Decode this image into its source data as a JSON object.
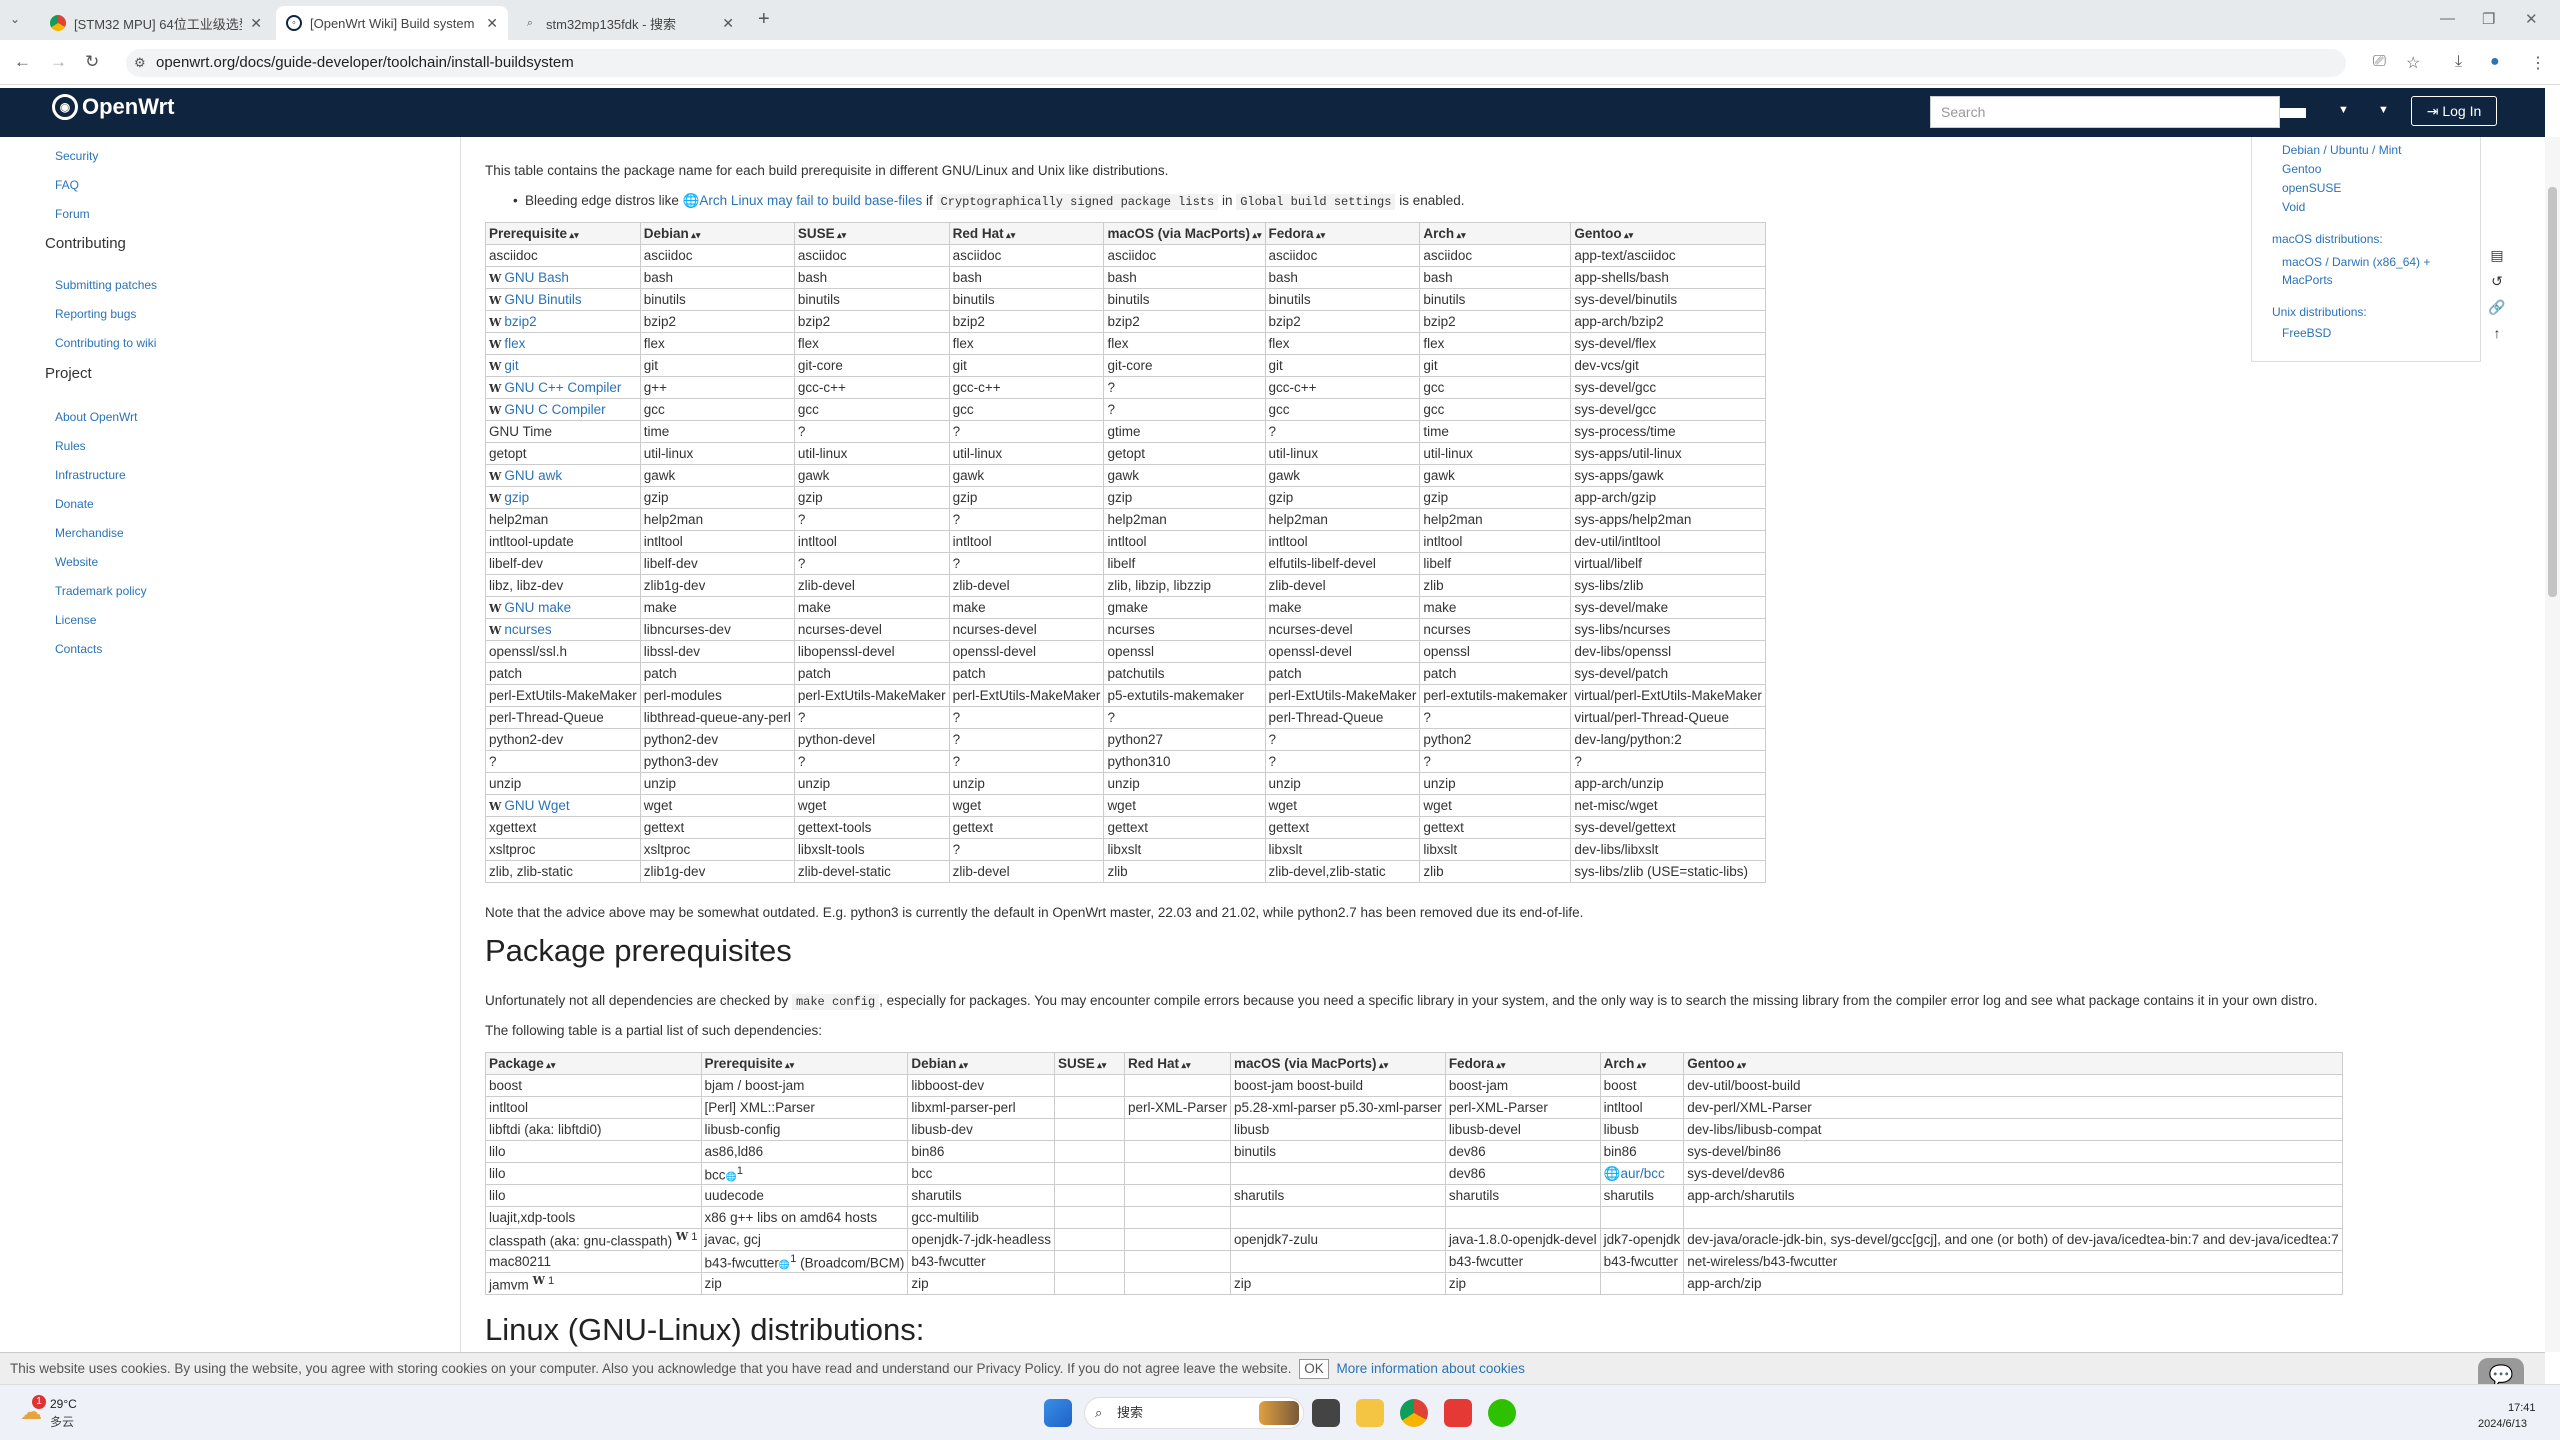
{
  "browser": {
    "tabs": [
      {
        "title": "[STM32 MPU] 64位工业级选型",
        "favicon": "chrome-icon"
      },
      {
        "title": "[OpenWrt Wiki] Build system",
        "favicon": "openwrt-icon"
      },
      {
        "title": "stm32mp135fdk - 搜索",
        "favicon": "search-icon"
      }
    ],
    "url": "openwrt.org/docs/guide-developer/toolchain/install-buildsystem"
  },
  "header": {
    "logo": "OpenWrt",
    "search_placeholder": "Search",
    "login": "Log In"
  },
  "sidebar": {
    "top_items": [
      "Security",
      "FAQ",
      "Forum"
    ],
    "contributing_heading": "Contributing",
    "contributing_items": [
      "Submitting patches",
      "Reporting bugs",
      "Contributing to wiki"
    ],
    "project_heading": "Project",
    "project_items": [
      "About OpenWrt",
      "Rules",
      "Infrastructure",
      "Donate",
      "Merchandise",
      "Website",
      "Trademark policy",
      "License",
      "Contacts"
    ]
  },
  "toc": {
    "linux_items": [
      "Debian / Ubuntu / Mint",
      "Gentoo",
      "openSUSE",
      "Void"
    ],
    "macos_heading": "macOS distributions:",
    "macos_item_1": "macOS / Darwin (x86_64) +",
    "macos_item_2": "MacPorts",
    "unix_heading": "Unix distributions:",
    "unix_item": "FreeBSD"
  },
  "content": {
    "intro": "This table contains the package name for each build prerequisite in different GNU/Linux and Unix like distributions.",
    "bullet_pre": "Bleeding edge distros like ",
    "bullet_link": "Arch Linux may fail to build base-files",
    "bullet_if": " if ",
    "bullet_code1": "Cryptographically signed package lists",
    "bullet_in": " in ",
    "bullet_code2": "Global build settings",
    "bullet_post": " is enabled.",
    "note": "Note that the advice above may be somewhat outdated. E.g. python3 is currently the default in OpenWrt master, 22.03 and 21.02, while python2.7 has been removed due its end-of-life.",
    "h_packages": "Package prerequisites",
    "pkg_intro_pre": "Unfortunately not all dependencies are checked by ",
    "pkg_intro_code": "make config",
    "pkg_intro_post": ", especially for packages. You may encounter compile errors because you need a specific library in your system, and the only way is to search the missing library from the compiler error log and see what package contains it in your own distro.",
    "pkg_intro2": "The following table is a partial list of such dependencies:",
    "h_linux": "Linux (GNU-Linux) distributions:"
  },
  "prereq_table": {
    "headers": [
      "Prerequisite",
      "Debian",
      "SUSE",
      "Red Hat",
      "macOS (via MacPorts)",
      "Fedora",
      "Arch",
      "Gentoo"
    ],
    "rows": [
      [
        "asciidoc",
        "asciidoc",
        "asciidoc",
        "asciidoc",
        "asciidoc",
        "asciidoc",
        "asciidoc",
        "app-text/asciidoc"
      ],
      [
        "GNU Bash",
        "bash",
        "bash",
        "bash",
        "bash",
        "bash",
        "bash",
        "app-shells/bash"
      ],
      [
        "GNU Binutils",
        "binutils",
        "binutils",
        "binutils",
        "binutils",
        "binutils",
        "binutils",
        "sys-devel/binutils"
      ],
      [
        "bzip2",
        "bzip2",
        "bzip2",
        "bzip2",
        "bzip2",
        "bzip2",
        "bzip2",
        "app-arch/bzip2"
      ],
      [
        "flex",
        "flex",
        "flex",
        "flex",
        "flex",
        "flex",
        "flex",
        "sys-devel/flex"
      ],
      [
        "git",
        "git",
        "git-core",
        "git",
        "git-core",
        "git",
        "git",
        "dev-vcs/git"
      ],
      [
        "GNU C++ Compiler",
        "g++",
        "gcc-c++",
        "gcc-c++",
        "?",
        "gcc-c++",
        "gcc",
        "sys-devel/gcc"
      ],
      [
        "GNU C Compiler",
        "gcc",
        "gcc",
        "gcc",
        "?",
        "gcc",
        "gcc",
        "sys-devel/gcc"
      ],
      [
        "GNU Time",
        "time",
        "?",
        "?",
        "gtime",
        "?",
        "time",
        "sys-process/time"
      ],
      [
        "getopt",
        "util-linux",
        "util-linux",
        "util-linux",
        "getopt",
        "util-linux",
        "util-linux",
        "sys-apps/util-linux"
      ],
      [
        "GNU awk",
        "gawk",
        "gawk",
        "gawk",
        "gawk",
        "gawk",
        "gawk",
        "sys-apps/gawk"
      ],
      [
        "gzip",
        "gzip",
        "gzip",
        "gzip",
        "gzip",
        "gzip",
        "gzip",
        "app-arch/gzip"
      ],
      [
        "help2man",
        "help2man",
        "?",
        "?",
        "help2man",
        "help2man",
        "help2man",
        "sys-apps/help2man"
      ],
      [
        "intltool-update",
        "intltool",
        "intltool",
        "intltool",
        "intltool",
        "intltool",
        "intltool",
        "dev-util/intltool"
      ],
      [
        "libelf-dev",
        "libelf-dev",
        "?",
        "?",
        "libelf",
        "elfutils-libelf-devel",
        "libelf",
        "virtual/libelf"
      ],
      [
        "libz, libz-dev",
        "zlib1g-dev",
        "zlib-devel",
        "zlib-devel",
        "zlib, libzip, libzzip",
        "zlib-devel",
        "zlib",
        "sys-libs/zlib"
      ],
      [
        "GNU make",
        "make",
        "make",
        "make",
        "gmake",
        "make",
        "make",
        "sys-devel/make"
      ],
      [
        "ncurses",
        "libncurses-dev",
        "ncurses-devel",
        "ncurses-devel",
        "ncurses",
        "ncurses-devel",
        "ncurses",
        "sys-libs/ncurses"
      ],
      [
        "openssl/ssl.h",
        "libssl-dev",
        "libopenssl-devel",
        "openssl-devel",
        "openssl",
        "openssl-devel",
        "openssl",
        "dev-libs/openssl"
      ],
      [
        "patch",
        "patch",
        "patch",
        "patch",
        "patchutils",
        "patch",
        "patch",
        "sys-devel/patch"
      ],
      [
        "perl-ExtUtils-MakeMaker",
        "perl-modules",
        "perl-ExtUtils-MakeMaker",
        "perl-ExtUtils-MakeMaker",
        "p5-extutils-makemaker",
        "perl-ExtUtils-MakeMaker",
        "perl-extutils-makemaker",
        "virtual/perl-ExtUtils-MakeMaker"
      ],
      [
        "perl-Thread-Queue",
        "libthread-queue-any-perl",
        "?",
        "?",
        "?",
        "perl-Thread-Queue",
        "?",
        "virtual/perl-Thread-Queue"
      ],
      [
        "python2-dev",
        "python2-dev",
        "python-devel",
        "?",
        "python27",
        "?",
        "python2",
        "dev-lang/python:2"
      ],
      [
        "?",
        "python3-dev",
        "?",
        "?",
        "python310",
        "?",
        "?",
        "?"
      ],
      [
        "unzip",
        "unzip",
        "unzip",
        "unzip",
        "unzip",
        "unzip",
        "unzip",
        "app-arch/unzip"
      ],
      [
        "GNU Wget",
        "wget",
        "wget",
        "wget",
        "wget",
        "wget",
        "wget",
        "net-misc/wget"
      ],
      [
        "xgettext",
        "gettext",
        "gettext-tools",
        "gettext",
        "gettext",
        "gettext",
        "gettext",
        "sys-devel/gettext"
      ],
      [
        "xsltproc",
        "xsltproc",
        "libxslt-tools",
        "?",
        "libxslt",
        "libxslt",
        "libxslt",
        "dev-libs/libxslt"
      ],
      [
        "zlib, zlib-static",
        "zlib1g-dev",
        "zlib-devel-static",
        "zlib-devel",
        "zlib",
        "zlib-devel,zlib-static",
        "zlib",
        "sys-libs/zlib (USE=static-libs)"
      ]
    ],
    "wiki_rows": [
      1,
      2,
      3,
      4,
      5,
      6,
      7,
      10,
      11,
      16,
      17,
      25
    ]
  },
  "pkg_table": {
    "headers": [
      "Package",
      "Prerequisite",
      "Debian",
      "SUSE",
      "Red Hat",
      "macOS (via MacPorts)",
      "Fedora",
      "Arch",
      "Gentoo"
    ],
    "rows": [
      [
        "boost",
        "bjam / boost-jam",
        "libboost-dev",
        "",
        "",
        "boost-jam boost-build",
        "boost-jam",
        "boost",
        "dev-util/boost-build"
      ],
      [
        "intltool",
        "[Perl] XML::Parser",
        "libxml-parser-perl",
        "",
        "perl-XML-Parser",
        "p5.28-xml-parser p5.30-xml-parser",
        "perl-XML-Parser",
        "intltool",
        "dev-perl/XML-Parser"
      ],
      [
        "libftdi (aka: libftdi0)",
        "libusb-config",
        "libusb-dev",
        "",
        "",
        "libusb",
        "libusb-devel",
        "libusb",
        "dev-libs/libusb-compat"
      ],
      [
        "lilo",
        "as86,ld86",
        "bin86",
        "",
        "",
        "binutils",
        "dev86",
        "bin86",
        "sys-devel/bin86"
      ],
      [
        "lilo",
        "bcc",
        "bcc",
        "",
        "",
        "",
        "dev86",
        "aur/bcc",
        "sys-devel/dev86"
      ],
      [
        "lilo",
        "uudecode",
        "sharutils",
        "",
        "",
        "sharutils",
        "sharutils",
        "sharutils",
        "app-arch/sharutils"
      ],
      [
        "luajit,xdp-tools",
        "x86 g++ libs on amd64 hosts",
        "gcc-multilib",
        "",
        "",
        "",
        "",
        "",
        ""
      ],
      [
        "classpath (aka: gnu-classpath)",
        "javac, gcj",
        "openjdk-7-jdk-headless",
        "",
        "",
        "openjdk7-zulu",
        "java-1.8.0-openjdk-devel",
        "jdk7-openjdk",
        "dev-java/oracle-jdk-bin, sys-devel/gcc[gcj], and one (or both) of dev-java/icedtea-bin:7 and dev-java/icedtea:7"
      ],
      [
        "mac80211",
        "b43-fwcutter",
        "b43-fwcutter",
        "",
        "",
        "",
        "b43-fwcutter",
        "b43-fwcutter",
        "net-wireless/b43-fwcutter"
      ],
      [
        "jamvm",
        "zip",
        "zip",
        "",
        "",
        "zip",
        "zip",
        "",
        "app-arch/zip"
      ]
    ],
    "bcc_footnote": "1",
    "b43_suffix": " (Broadcom/BCM)",
    "b43_footnote": "1",
    "classpath_footnote": "1",
    "jamvm_footnote": "1"
  },
  "cookie": {
    "text": "This website uses cookies. By using the website, you agree with storing cookies on your computer. Also you acknowledge that you have read and understand our Privacy Policy. If you do not agree leave the website.",
    "ok": "OK",
    "more": "More information about cookies"
  },
  "taskbar": {
    "weather_temp": "29°C",
    "weather_desc": "多云",
    "weather_badge": "1",
    "search_label": "搜索",
    "time": "17:41",
    "date": "2024/6/13"
  }
}
